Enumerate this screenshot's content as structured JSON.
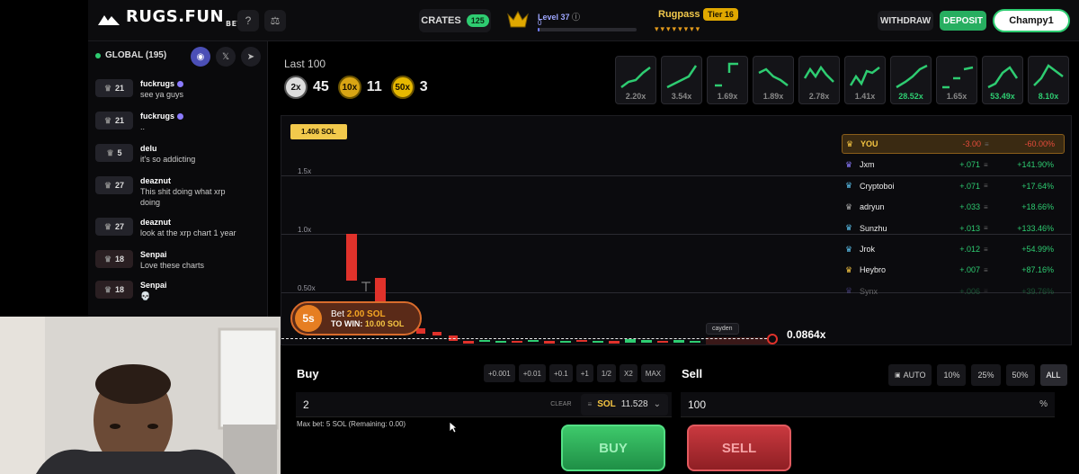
{
  "header": {
    "logo": "RUGS.FUN",
    "logo_badge": "BETA",
    "help_icon": "question-icon",
    "scale_icon": "scale-icon",
    "crates_label": "CRATES",
    "crates_count": "125",
    "level_label": "Level 37",
    "level_value": "0",
    "level_progress": 0.02,
    "rugpass_label": "Rugpass",
    "tier_label": "Tier 16",
    "withdraw_label": "WITHDRAW",
    "deposit_label": "DEPOSIT",
    "username": "Champy1"
  },
  "chat": {
    "header": "GLOBAL (195)",
    "messages": [
      {
        "level": "21",
        "name": "fuckrugs",
        "text": "see ya guys",
        "verified": true
      },
      {
        "level": "21",
        "name": "fuckrugs",
        "text": "..",
        "verified": true
      },
      {
        "level": "5",
        "name": "delu",
        "text": "it's so addicting",
        "verified": false
      },
      {
        "level": "27",
        "name": "deaznut",
        "text": "This shit doing what xrp",
        "text2": "doing",
        "verified": false
      },
      {
        "level": "27",
        "name": "deaznut",
        "text": "look at the xrp chart 1 year",
        "verified": false
      },
      {
        "level": "18",
        "name": "Senpai",
        "text": "Love these charts",
        "verified": false
      },
      {
        "level": "18",
        "name": "Senpai",
        "text": "💀",
        "verified": false
      }
    ]
  },
  "history": {
    "title": "Last 100",
    "stats": [
      {
        "chip": "2x",
        "count": "45"
      },
      {
        "chip": "10x",
        "count": "11"
      },
      {
        "chip": "50x",
        "count": "3"
      }
    ],
    "minis": [
      {
        "value": "2.20x",
        "green": false
      },
      {
        "value": "3.54x",
        "green": false
      },
      {
        "value": "1.69x",
        "green": false
      },
      {
        "value": "1.89x",
        "green": false
      },
      {
        "value": "2.78x",
        "green": false
      },
      {
        "value": "1.41x",
        "green": false
      },
      {
        "value": "28.52x",
        "green": true
      },
      {
        "value": "1.65x",
        "green": false
      },
      {
        "value": "53.49x",
        "green": true
      },
      {
        "value": "8.10x",
        "green": true
      }
    ]
  },
  "chart": {
    "sol_pill": "1.406 SOL",
    "y_labels": [
      "1.5x",
      "1.0x",
      "0.50x"
    ],
    "current_multiplier": "0.0864x",
    "bet_timer": "5s",
    "bet_label": "Bet",
    "bet_amount": "2.00 SOL",
    "win_label": "TO WIN:",
    "win_amount": "10.00 SOL",
    "marker_name": "cayden"
  },
  "leaderboard": [
    {
      "name": "YOU",
      "amount": "-3.00",
      "pct": "-60.00%",
      "you": true,
      "crown": "#f5c542"
    },
    {
      "name": "Jxm",
      "amount": "+.071",
      "pct": "+141.90%",
      "crown": "#8b7bff"
    },
    {
      "name": "Cryptoboi",
      "amount": "+.071",
      "pct": "+17.64%",
      "crown": "#5bc0eb"
    },
    {
      "name": "adryun",
      "amount": "+.033",
      "pct": "+18.66%",
      "crown": "#aaaaaa"
    },
    {
      "name": "Sunzhu",
      "amount": "+.013",
      "pct": "+133.46%",
      "crown": "#5bc0eb"
    },
    {
      "name": "Jrok",
      "amount": "+.012",
      "pct": "+54.99%",
      "crown": "#5bc0eb"
    },
    {
      "name": "Heybro",
      "amount": "+.007",
      "pct": "+87.16%",
      "crown": "#f5c542"
    },
    {
      "name": "Synx",
      "amount": "+.006",
      "pct": "+39.76%",
      "crown": "#8b7bff"
    }
  ],
  "buy": {
    "title": "Buy",
    "quick": [
      "+0.001",
      "+0.01",
      "+0.1",
      "+1",
      "1/2",
      "X2",
      "MAX"
    ],
    "value": "2",
    "clear": "CLEAR",
    "currency": "SOL",
    "balance": "11.528",
    "max_bet": "Max bet: 5 SOL (Remaining: 0.00)",
    "button": "BUY"
  },
  "sell": {
    "title": "Sell",
    "auto": "AUTO",
    "pcts": [
      "10%",
      "25%",
      "50%",
      "ALL"
    ],
    "value": "100",
    "unit": "%",
    "button": "SELL"
  },
  "colors": {
    "accent_gold": "#f5c542",
    "buy_green": "#2ecc71",
    "sell_red": "#e74c3c"
  }
}
